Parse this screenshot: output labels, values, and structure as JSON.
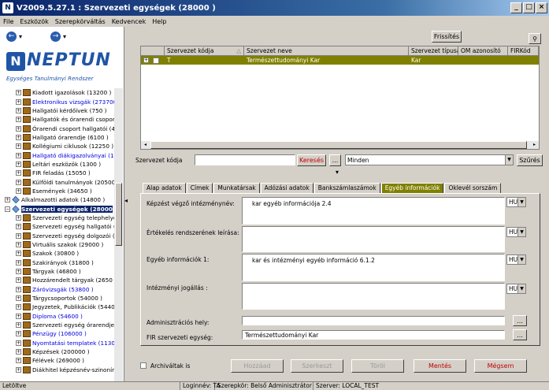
{
  "window": {
    "title": "V2009.5.27.1 : Szervezeti egységek (28000 )",
    "app_icon": "N"
  },
  "menu": [
    "File",
    "Eszközök",
    "Szerepkörváltás",
    "Kedvencek",
    "Help"
  ],
  "logo": {
    "brand": "NEPTUN",
    "subtitle": "Egységes Tanulmányi Rendszer"
  },
  "tree": [
    {
      "label": "Kiadott igazolások (13200 )",
      "style": "normal",
      "level": 2
    },
    {
      "label": "Elektronikus vizsgák (273700",
      "style": "blue",
      "level": 2
    },
    {
      "label": "Hallgatói kérdőívek (750 )",
      "style": "normal",
      "level": 2
    },
    {
      "label": "Hallgatók és órarendi csoporto",
      "style": "normal",
      "level": 2
    },
    {
      "label": "Órarendi csoport hallgatói (435",
      "style": "normal",
      "level": 2
    },
    {
      "label": "Hallgató órarendje (6100 )",
      "style": "normal",
      "level": 2
    },
    {
      "label": "Kollégiumi ciklusok (12250 )",
      "style": "normal",
      "level": 2
    },
    {
      "label": "Hallgató diákigazolványai (115",
      "style": "blue",
      "level": 2
    },
    {
      "label": "Leltári eszközök (1300 )",
      "style": "normal",
      "level": 2
    },
    {
      "label": "FIR feladás (15050 )",
      "style": "normal",
      "level": 2
    },
    {
      "label": "Külföldi tanulmányok (20500 )",
      "style": "normal",
      "level": 2
    },
    {
      "label": "Események (34650 )",
      "style": "normal",
      "level": 2
    },
    {
      "label": "Alkalmazotti adatok (14800 )",
      "style": "normal",
      "level": 1
    },
    {
      "label": "Szervezeti egységek (28000",
      "style": "selected",
      "level": 1
    },
    {
      "label": "Szervezeti egység telephelyei (",
      "style": "normal",
      "level": 2
    },
    {
      "label": "Szervezeti egység hallgatói (28",
      "style": "normal",
      "level": 2
    },
    {
      "label": "Szervezeti egység dolgozói (28",
      "style": "normal",
      "level": 2
    },
    {
      "label": "Virtuális szakok (29000 )",
      "style": "normal",
      "level": 2
    },
    {
      "label": "Szakok (30800 )",
      "style": "normal",
      "level": 2
    },
    {
      "label": "Szakirányok (31800 )",
      "style": "normal",
      "level": 2
    },
    {
      "label": "Tárgyak (46800 )",
      "style": "normal",
      "level": 2
    },
    {
      "label": "Hozzárendelt tárgyak (2650 )",
      "style": "normal",
      "level": 2
    },
    {
      "label": "Záróvizsgák (53800 )",
      "style": "blue",
      "level": 2
    },
    {
      "label": "Tárgycsoportok (54000 )",
      "style": "normal",
      "level": 2
    },
    {
      "label": "Jegyzetek, Publikációk (54400",
      "style": "normal",
      "level": 2
    },
    {
      "label": "Diploma (54600 )",
      "style": "blue",
      "level": 2
    },
    {
      "label": "Szervezeti egység órarendje (5",
      "style": "normal",
      "level": 2
    },
    {
      "label": "Pénzügy (106000 )",
      "style": "blue",
      "level": 2
    },
    {
      "label": "Nyomtatási templatek (113000",
      "style": "blue",
      "level": 2
    },
    {
      "label": "Képzések (200000 )",
      "style": "normal",
      "level": 2
    },
    {
      "label": "Félévek (269000 )",
      "style": "normal",
      "level": 2
    },
    {
      "label": "Diákhitel képzésnév-szinonímá",
      "style": "normal",
      "level": 2
    }
  ],
  "toolbar": {
    "refresh": "Frissítés"
  },
  "grid": {
    "columns": [
      "Szervezet kódja",
      "Szervezet neve",
      "Szervezet típusa",
      "OM azonosító",
      "FIRKód"
    ],
    "rows": [
      [
        "T",
        "Természettudományi  Kar",
        "Kar",
        "",
        ""
      ]
    ]
  },
  "search": {
    "label": "Szervezet kódja",
    "value": "",
    "search_btn": "Keresés",
    "more_btn": "...",
    "filter_value": "Minden",
    "filter_btn": "Szűrés"
  },
  "tabs": [
    "Alap adatok",
    "Címek",
    "Munkatársak",
    "Adózási adatok",
    "Bankszámlaszámok",
    "Egyéb információk",
    "Oklevél sorszám"
  ],
  "active_tab": 5,
  "form": {
    "kepzest": {
      "label": "Képzést végző intézménynév:",
      "value": "kar egyéb információja 2.4",
      "lang": "HU"
    },
    "ertekeles": {
      "label": "Értékelés rendszerének leírása:",
      "value": "",
      "lang": "HU"
    },
    "egyeb": {
      "label": "Egyéb információk 1:",
      "value": "kar és intézményi egyéb információ 6.1.2",
      "lang": "HU"
    },
    "intezmenyi": {
      "label": "Intézményi jogállás :",
      "value": "",
      "lang": "HU"
    },
    "admin": {
      "label": "Adminisztrációs hely:",
      "value": ""
    },
    "fir": {
      "label": "FIR szervezeti egység:",
      "value": "Természettudományi  Kar"
    },
    "browse": "..."
  },
  "actions": {
    "archived": "Archiváltak is",
    "add": "Hozzáad",
    "edit": "Szerkeszt",
    "delete": "Töröl",
    "save": "Mentés",
    "cancel": "Mégsem"
  },
  "status": {
    "state": "Letöltve",
    "login": "Loginnév: TA",
    "role": "Szerepkör: Belső Adminisztrátor",
    "server": "Szerver: LOCAL_TEST"
  },
  "colors": {
    "accent": "#808000",
    "title": "#0a246a",
    "selected": "#0a246a",
    "link": "#0000e0"
  }
}
